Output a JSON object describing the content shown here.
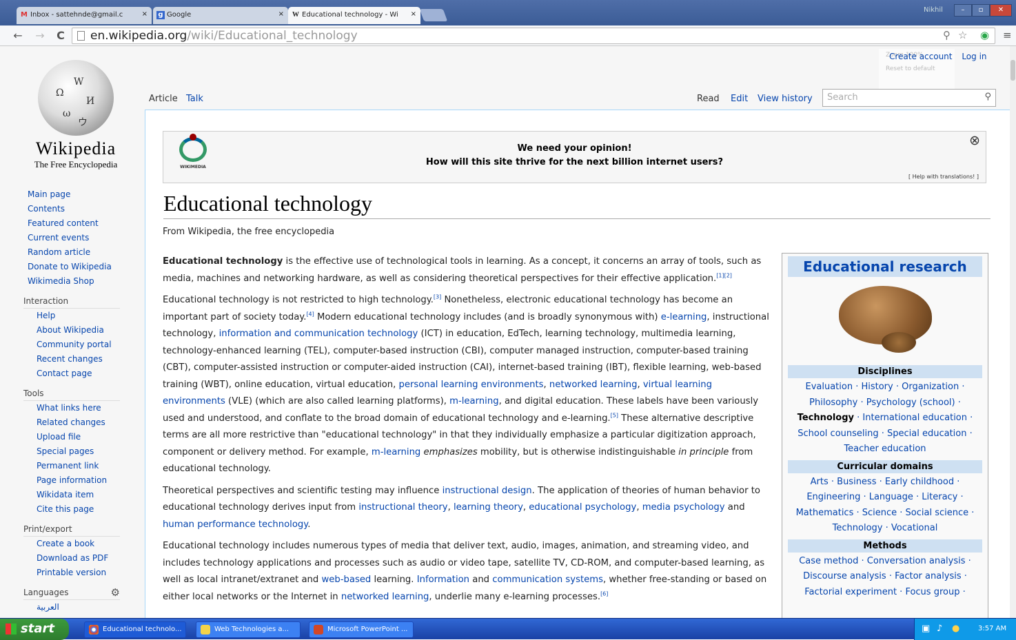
{
  "browser": {
    "tabs": [
      {
        "title": "Inbox - sattehnde@gmail.c",
        "icon": "gmail-icon",
        "close": "×"
      },
      {
        "title": "Google",
        "icon": "google-icon",
        "close": "×"
      },
      {
        "title": "Educational technology - Wi",
        "icon": "wikipedia-icon",
        "close": "×"
      }
    ],
    "window_user": "Nikhil",
    "url_domain": "en.wikipedia.org",
    "url_path": "/wiki/Educational_technology"
  },
  "wiki": {
    "wordmark": "Wikipedia",
    "tagline": "The Free Encyclopedia",
    "personal": {
      "create": "Create account",
      "login": "Log in"
    },
    "zoom": {
      "label": "Zoom",
      "value": "100%",
      "reset": "Reset to default"
    },
    "ns_tabs": {
      "article": "Article",
      "talk": "Talk"
    },
    "view_tabs": {
      "read": "Read",
      "edit": "Edit",
      "history": "View history"
    },
    "search_placeholder": "Search",
    "banner": {
      "line1": "We need your opinion!",
      "line2": "How will this site thrive for the next billion internet users?",
      "help": "[ Help with translations! ]",
      "logo_label": "WIKIMEDIA"
    },
    "title": "Educational technology",
    "from": "From Wikipedia, the free encyclopedia",
    "nav": [
      "Main page",
      "Contents",
      "Featured content",
      "Current events",
      "Random article",
      "Donate to Wikipedia",
      "Wikimedia Shop"
    ],
    "interaction_heading": "Interaction",
    "interaction": [
      "Help",
      "About Wikipedia",
      "Community portal",
      "Recent changes",
      "Contact page"
    ],
    "tools_heading": "Tools",
    "tools": [
      "What links here",
      "Related changes",
      "Upload file",
      "Special pages",
      "Permanent link",
      "Page information",
      "Wikidata item",
      "Cite this page"
    ],
    "print_heading": "Print/export",
    "print": [
      "Create a book",
      "Download as PDF",
      "Printable version"
    ],
    "languages_heading": "Languages",
    "languages_partial": "العربية"
  },
  "article": {
    "p1": {
      "bold": "Educational technology",
      "text": " is the effective use of technological tools in learning. As a concept, it concerns an array of tools, such as media, machines and networking hardware, as well as considering theoretical perspectives for their effective application.",
      "ref": "[1][2]"
    },
    "p2": {
      "a": "Educational technology is not restricted to high technology.",
      "ref3": "[3]",
      "b": " Nonetheless, electronic educational technology has become an important part of society today.",
      "ref4": "[4]",
      "c": " Modern educational technology includes (and is broadly synonymous with) ",
      "link_elearning": "e-learning",
      "d": ", instructional technology, ",
      "link_ict": "information and communication technology",
      "e": " (ICT) in education, EdTech, learning technology, multimedia learning, technology-enhanced learning (TEL), computer-based instruction (CBI), computer managed instruction, computer-based training (CBT), computer-assisted instruction or computer-aided instruction (CAI), internet-based training (IBT), flexible learning, web-based training (WBT), online education, virtual education, ",
      "link_ple": "personal learning environments",
      "f": ", ",
      "link_netl": "networked learning",
      "g": ", ",
      "link_vle": "virtual learning environments",
      "h": " (VLE) (which are also called learning platforms), ",
      "link_ml": "m-learning",
      "i": ", and digital education. These labels have been variously used and understood, and conflate to the broad domain of educational technology and e-learning.",
      "ref5": "[5]",
      "j": " These alternative descriptive terms are all more restrictive than \"educational technology\" in that they individually emphasize a particular digitization approach, component or delivery method. For example, ",
      "link_ml2": "m-learning",
      "k_em": " emphasizes",
      "l": " mobility, but is otherwise indistinguishable ",
      "m_em": "in principle",
      "n": " from educational technology."
    },
    "p3": {
      "a": "Theoretical perspectives and scientific testing may influence ",
      "link_id": "instructional design",
      "b": ". The application of theories of human behavior to educational technology derives input from ",
      "link_it": "instructional theory",
      "c": ", ",
      "link_lt": "learning theory",
      "d": ", ",
      "link_ep": "educational psychology",
      "e": ", ",
      "link_mp": "media psychology",
      "f": " and ",
      "link_hpt": "human performance technology",
      "g": "."
    },
    "p4": {
      "a": "Educational technology includes numerous types of media that deliver text, audio, images, animation, and streaming video, and includes technology applications and processes such as audio or video tape, satellite TV, CD-ROM, and computer-based learning, as well as local intranet/extranet and ",
      "link_web": "web-based",
      "b": " learning. ",
      "link_info": "Information",
      "c": " and ",
      "link_comm": "communication systems",
      "d": ", whether free-standing or based on either local networks or the Internet in ",
      "link_nl": "networked learning",
      "e": ", underlie many e-learning processes.",
      "ref6": "[6]"
    }
  },
  "infobox": {
    "title": "Educational research",
    "disciplines_h": "Disciplines",
    "disciplines_1": "Evaluation · History · Organization ·",
    "disciplines_2": "Philosophy · Psychology (school) ·",
    "tech_bold": "Technology",
    "disciplines_3": " · International education ·",
    "disciplines_4": "School counseling · Special education ·",
    "disciplines_5": "Teacher education",
    "curr_h": "Curricular domains",
    "curr_1": "Arts · Business · Early childhood ·",
    "curr_2": "Engineering · Language · Literacy ·",
    "curr_3": "Mathematics · Science · Social science ·",
    "curr_4": "Technology · Vocational",
    "methods_h": "Methods",
    "methods_1": "Case method · Conversation analysis ·",
    "methods_2": "Discourse analysis · Factor analysis ·",
    "methods_3": "Factorial experiment · Focus group ·"
  },
  "taskbar": {
    "start": "start",
    "tasks": [
      "Educational technolo...",
      "Web Technologies a...",
      "Microsoft PowerPoint ..."
    ],
    "clock": "3:57 AM"
  }
}
